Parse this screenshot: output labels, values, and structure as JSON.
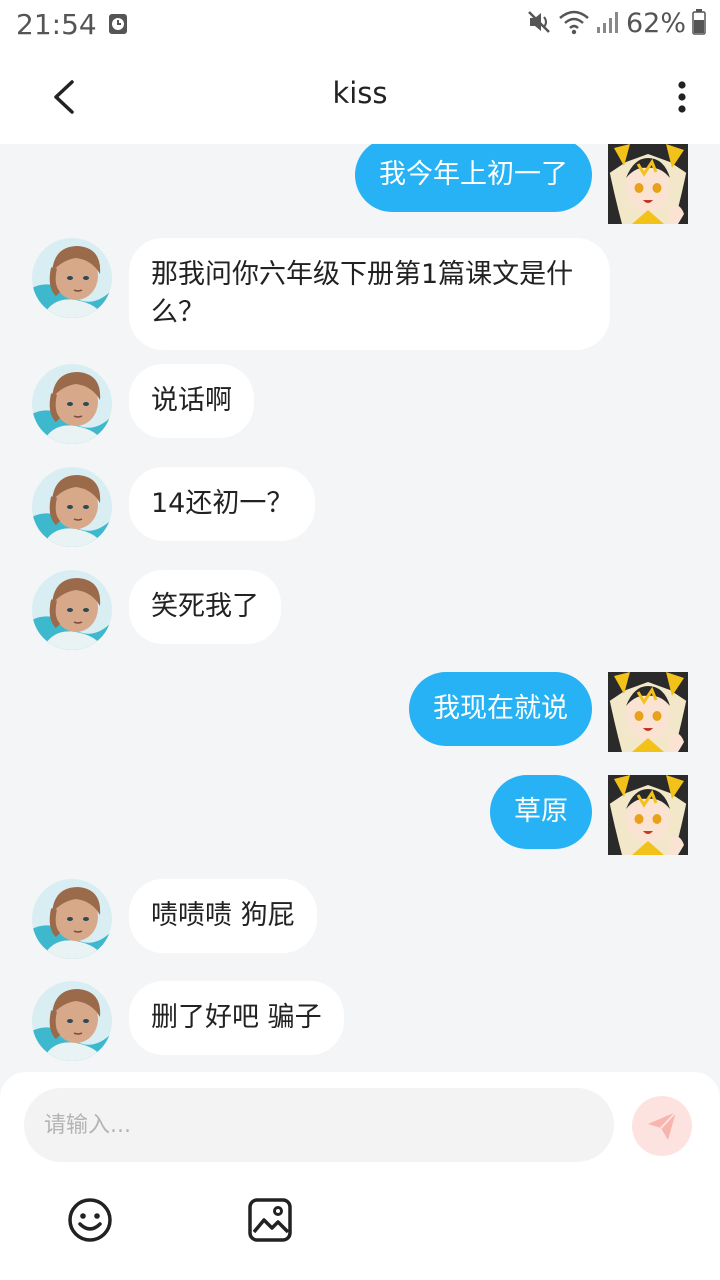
{
  "status_bar": {
    "time": "21:54",
    "battery": "62%"
  },
  "header": {
    "title": "kiss",
    "back_icon": "chevron-left-icon",
    "more_icon": "more-vertical-icon"
  },
  "messages": [
    {
      "side": "right",
      "text": "我今年上初一了"
    },
    {
      "side": "left",
      "text": "那我问你六年级下册第1篇课文是什么？"
    },
    {
      "side": "left",
      "text": "说话啊"
    },
    {
      "side": "left",
      "text": "14还初一？"
    },
    {
      "side": "left",
      "text": "笑死我了"
    },
    {
      "side": "right",
      "text": "我现在就说"
    },
    {
      "side": "right",
      "text": "草原"
    },
    {
      "side": "left",
      "text": "啧啧啧 狗屁"
    },
    {
      "side": "left",
      "text": "删了好吧 骗子"
    }
  ],
  "composer": {
    "placeholder": "请输入...",
    "send_icon": "send-icon",
    "emoji_icon": "emoji-icon",
    "image_icon": "image-icon"
  },
  "colors": {
    "outgoing_bubble": "#26b2f4",
    "incoming_bubble": "#ffffff",
    "background": "#f3f5f7",
    "send_button": "#fde3e0"
  }
}
